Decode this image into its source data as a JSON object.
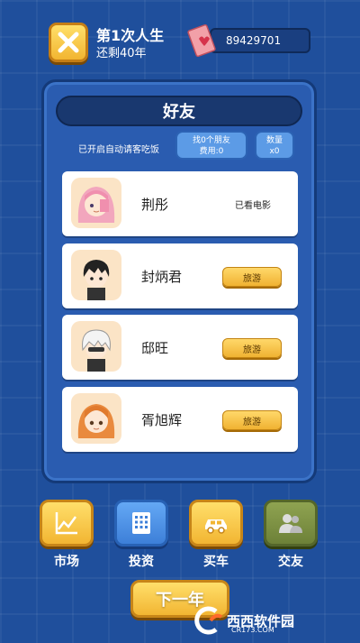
{
  "header": {
    "life_title": "第1次人生",
    "remaining": "还剩40年",
    "money": "89429701"
  },
  "panel": {
    "title": "好友",
    "auto_text": "已开启自动请客吃饭",
    "find_line1": "找0个朋友",
    "find_line2": "费用:0",
    "count_line1": "数量",
    "count_line2": "x0"
  },
  "friends": [
    {
      "name": "荆彤",
      "status": "已看电影"
    },
    {
      "name": "封炳君",
      "button": "旅游"
    },
    {
      "name": "邸旺",
      "button": "旅游"
    },
    {
      "name": "胥旭辉",
      "button": "旅游"
    }
  ],
  "bottom_nav": [
    {
      "label": "市场",
      "icon": "chart-icon"
    },
    {
      "label": "投资",
      "icon": "calculator-icon"
    },
    {
      "label": "买车",
      "icon": "car-icon"
    },
    {
      "label": "交友",
      "icon": "friends-icon"
    }
  ],
  "next_label": "下一年",
  "watermark": {
    "text": "西西软件园",
    "url": "CR173.COM"
  },
  "colors": {
    "background": "#1f4f9c",
    "accent": "#f2b532",
    "panel": "#2a5cb0"
  }
}
